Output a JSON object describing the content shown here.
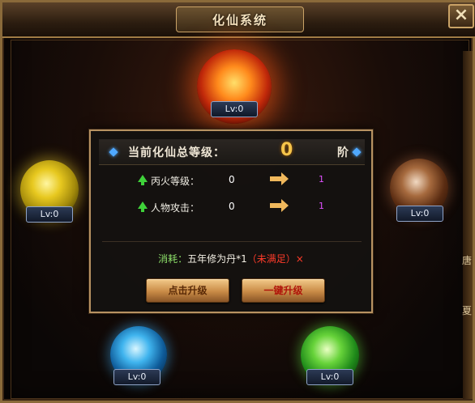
{
  "window": {
    "title": "化仙系统",
    "close_label": "×"
  },
  "orbs": {
    "fire": {
      "level": "Lv:0",
      "color": "#ff6a1c"
    },
    "gold": {
      "level": "Lv:0",
      "color": "#e7c81f"
    },
    "earth": {
      "level": "Lv:0",
      "color": "#a66a3e"
    },
    "water": {
      "level": "Lv:0",
      "color": "#3fb4ee"
    },
    "wood": {
      "level": "Lv:0",
      "color": "#67d33a"
    }
  },
  "dialog": {
    "total_label": "当前化仙总等级：",
    "total_value": "0",
    "total_unit": "阶",
    "stats": [
      {
        "label": "丙火等级：",
        "current": "0",
        "next": "1"
      },
      {
        "label": "人物攻击：",
        "current": "0",
        "next": "1"
      }
    ],
    "cost": {
      "prefix": "消耗：",
      "item": "五年修为丹*1",
      "status": "（未满足）×"
    },
    "buttons": {
      "upgrade": "点击升级",
      "one_click": "一键升级"
    }
  },
  "side_text": [
    "唐",
    "夏"
  ],
  "colors": {
    "accent_gold": "#f6c44a",
    "next_value": "#e050ff",
    "unsatisfied": "#ff3b2a",
    "cost_prefix": "#8de06a"
  }
}
